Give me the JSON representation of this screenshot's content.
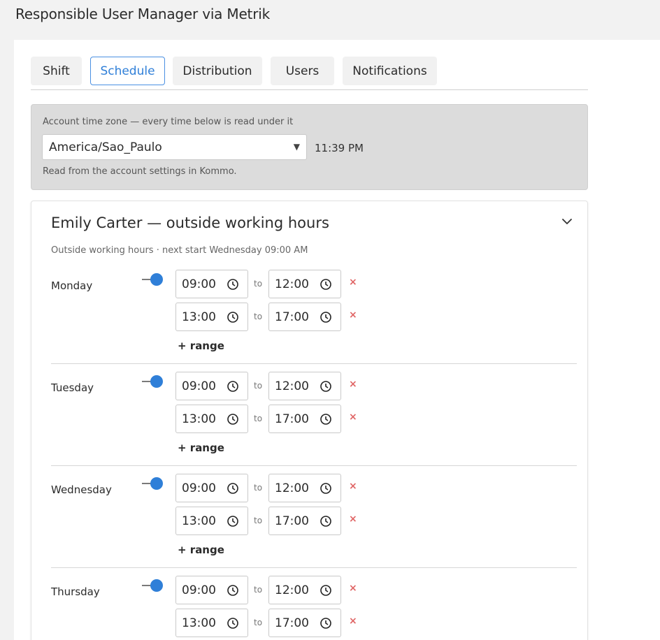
{
  "app": {
    "title": "Responsible User Manager via Metrik"
  },
  "tabs": [
    {
      "label": "Shift",
      "active": false
    },
    {
      "label": "Schedule",
      "active": true
    },
    {
      "label": "Distribution",
      "active": false
    },
    {
      "label": "Users",
      "active": false
    },
    {
      "label": "Notifications",
      "active": false
    }
  ],
  "timezone": {
    "label": "Account time zone — every time below is read under it",
    "value": "America/Sao_Paulo",
    "current_time": "11:39 PM",
    "note": "Read from the account settings in Kommo."
  },
  "user": {
    "title": "Emily Carter — outside working hours",
    "status": "Outside working hours · next start Wednesday 09:00 AM",
    "days": [
      {
        "name": "Monday",
        "enabled": true,
        "ranges": [
          {
            "from": "09:00",
            "to": "12:00"
          },
          {
            "from": "13:00",
            "to": "17:00"
          }
        ],
        "add_label": "+ range"
      },
      {
        "name": "Tuesday",
        "enabled": true,
        "ranges": [
          {
            "from": "09:00",
            "to": "12:00"
          },
          {
            "from": "13:00",
            "to": "17:00"
          }
        ],
        "add_label": "+ range"
      },
      {
        "name": "Wednesday",
        "enabled": true,
        "ranges": [
          {
            "from": "09:00",
            "to": "12:00"
          },
          {
            "from": "13:00",
            "to": "17:00"
          }
        ],
        "add_label": "+ range"
      },
      {
        "name": "Thursday",
        "enabled": true,
        "ranges": [
          {
            "from": "09:00",
            "to": "12:00"
          },
          {
            "from": "13:00",
            "to": "17:00"
          }
        ],
        "add_label": "+ range"
      }
    ]
  },
  "labels": {
    "to": "to",
    "remove": "×"
  },
  "icons": {
    "collapse": "chevron-down-icon",
    "time": "clock-icon",
    "dropdown": "caret-down-icon",
    "remove": "close-icon"
  },
  "colors": {
    "accent": "#2f7fd8",
    "remove": "#e06565"
  }
}
